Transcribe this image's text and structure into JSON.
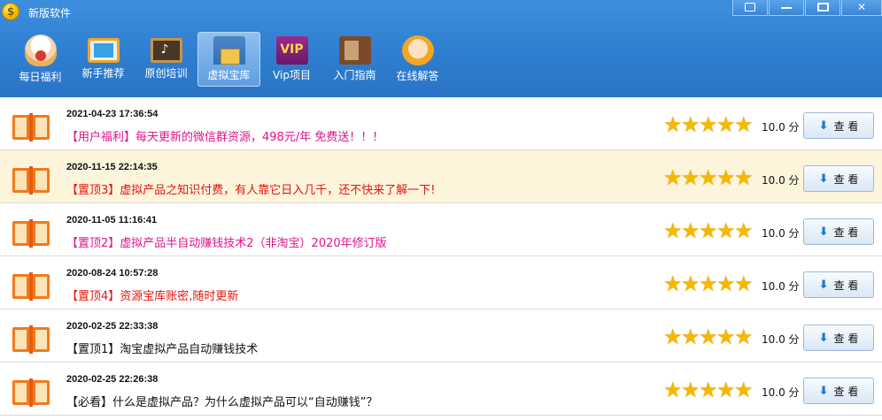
{
  "window": {
    "title": "新版软件",
    "logo_glyph": "$"
  },
  "nav": {
    "items": [
      {
        "label": "每日福利",
        "icon": "lucky-cat-icon"
      },
      {
        "label": "新手推荐",
        "icon": "monitor-icon"
      },
      {
        "label": "原创培训",
        "icon": "chalkboard-icon"
      },
      {
        "label": "虚拟宝库",
        "icon": "warehouse-icon",
        "active": true
      },
      {
        "label": "Vip项目",
        "icon": "vip-icon",
        "icon_text": "VIP"
      },
      {
        "label": "入门指南",
        "icon": "book-stack-icon"
      },
      {
        "label": "在线解答",
        "icon": "support-agent-icon"
      }
    ]
  },
  "colors": {
    "magenta": "#e0148c",
    "red": "#e3140e",
    "black": "#111111",
    "star": "#f5b800",
    "highlight_row": "#fdf4dc"
  },
  "list": {
    "view_label": "查 看",
    "rows": [
      {
        "date": "2021-04-23 17:36:54",
        "title": "【用户福利】每天更新的微信群资源，498元/年 免费送！！！",
        "color": "#e0148c",
        "stars": 5,
        "score": "10.0 分"
      },
      {
        "date": "2020-11-15 22:14:35",
        "title": "【置顶3】虚拟产品之知识付费，有人靠它日入几千，还不快来了解一下!",
        "color": "#e3140e",
        "stars": 5,
        "score": "10.0 分",
        "highlight": true
      },
      {
        "date": "2020-11-05 11:16:41",
        "title": "【置顶2】虚拟产品半自动赚钱技术2（非淘宝）2020年修订版",
        "color": "#e0148c",
        "stars": 5,
        "score": "10.0 分"
      },
      {
        "date": "2020-08-24 10:57:28",
        "title": "【置顶4】资源宝库账密,随时更新",
        "color": "#e3140e",
        "stars": 5,
        "score": "10.0 分"
      },
      {
        "date": "2020-02-25 22:33:38",
        "title": "【置顶1】淘宝虚拟产品自动赚钱技术",
        "color": "#111111",
        "stars": 5,
        "score": "10.0 分"
      },
      {
        "date": "2020-02-25 22:26:38",
        "title": "【必看】什么是虚拟产品？为什么虚拟产品可以“自动赚钱”？",
        "color": "#111111",
        "stars": 5,
        "score": "10.0 分"
      }
    ]
  }
}
